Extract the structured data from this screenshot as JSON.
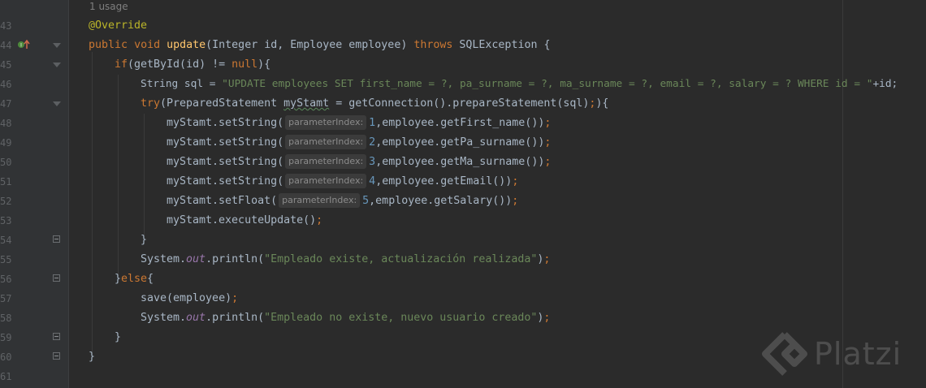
{
  "editor": {
    "usage_hint": "1 usage",
    "lines": [
      {
        "num": "43"
      },
      {
        "num": "44"
      },
      {
        "num": "45"
      },
      {
        "num": "46"
      },
      {
        "num": "47"
      },
      {
        "num": "48"
      },
      {
        "num": "49"
      },
      {
        "num": "50"
      },
      {
        "num": "51"
      },
      {
        "num": "52"
      },
      {
        "num": "53"
      },
      {
        "num": "54"
      },
      {
        "num": "55"
      },
      {
        "num": "56"
      },
      {
        "num": "57"
      },
      {
        "num": "58"
      },
      {
        "num": "59"
      },
      {
        "num": "60"
      },
      {
        "num": "61"
      }
    ],
    "code": {
      "annotation": "@Override",
      "kw_public": "public",
      "kw_void": "void",
      "method_update": "update",
      "sig_params": "(Integer id, Employee employee) ",
      "kw_throws": "throws",
      "sig_exc": " SQLException {",
      "kw_if": "if",
      "if_cond": "(getById(id) != ",
      "kw_null": "null",
      "if_close": "){",
      "sql_decl": "String sql = ",
      "sql_str": "\"UPDATE employees SET first_name = ?, pa_surname = ?, ma_surname = ?, email = ?, salary = ? WHERE id = \"",
      "sql_tail": "+id;",
      "kw_try": "try",
      "try_a": "(PreparedStatement ",
      "try_var": "myStamt",
      "try_b": " = getConnection().prepareStatement(sql)",
      "try_semi": ";",
      "try_c": "){",
      "set_string": "myStamt.setString(",
      "set_float": "myStamt.setFloat(",
      "param_hint": "parameterIndex:",
      "n1": "1",
      "n2": "2",
      "n3": "3",
      "n4": "4",
      "n5": "5",
      "arg1": ",employee.getFirst_name())",
      "arg2": ",employee.getPa_surname())",
      "arg3": ",employee.getMa_surname())",
      "arg4": ",employee.getEmail())",
      "arg5": ",employee.getSalary())",
      "semi": ";",
      "exec": "myStamt.executeUpdate()",
      "close_brace": "}",
      "sys": "System.",
      "out": "out",
      "println": ".println(",
      "msg1": "\"Empleado existe, actualización realizada\"",
      "paren_close": ")",
      "else_open": "}",
      "kw_else": "else",
      "else_brace": "{",
      "save_call": "save(employee)",
      "msg2": "\"Empleado no existe, nuevo usuario creado\""
    },
    "watermark": "Platzi"
  }
}
